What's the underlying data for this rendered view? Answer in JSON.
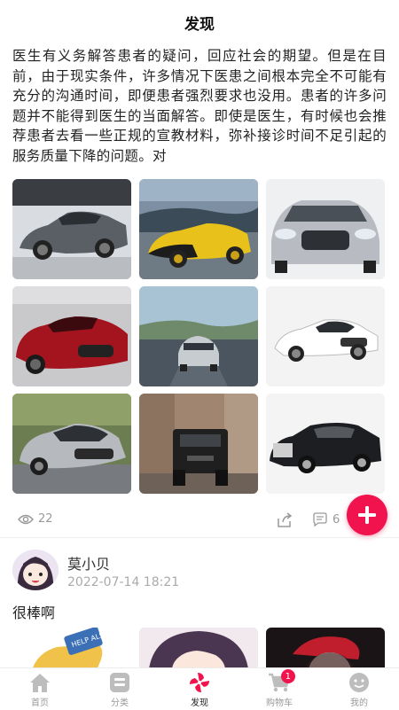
{
  "header": {
    "title": "发现"
  },
  "post": {
    "text": "医生有义务解答患者的疑问，回应社会的期望。但是在目前，由于现实条件，许多情况下医患之间根本完全不可能有充分的沟通时间，即便患者强烈要求也没用。患者的许多问题并不能得到医生的当面解答。即使是医生，有时候也会推荐患者去看一些正规的宣教材料，弥补接诊时间不足引起的服务质量下降的问题。对",
    "images": [
      {
        "name": "gray-sports-car"
      },
      {
        "name": "yellow-supercar"
      },
      {
        "name": "silver-sedan-front"
      },
      {
        "name": "red-convertible"
      },
      {
        "name": "silver-suv-road"
      },
      {
        "name": "white-coupe"
      },
      {
        "name": "silver-gtr"
      },
      {
        "name": "black-offroad-suv"
      },
      {
        "name": "black-luxury-sedan"
      }
    ],
    "views": "22",
    "comments": "6"
  },
  "comment": {
    "username": "莫小贝",
    "time": "2022-07-14 18:21",
    "text": "很棒啊"
  },
  "tabbar": {
    "items": [
      {
        "label": "首页",
        "icon": "home-icon"
      },
      {
        "label": "分类",
        "icon": "category-icon"
      },
      {
        "label": "发现",
        "icon": "discover-icon",
        "active": true
      },
      {
        "label": "购物车",
        "icon": "cart-icon",
        "badge": "1"
      },
      {
        "label": "我的",
        "icon": "profile-icon"
      }
    ]
  },
  "colors": {
    "accent": "#f0134d",
    "muted": "#999999"
  }
}
